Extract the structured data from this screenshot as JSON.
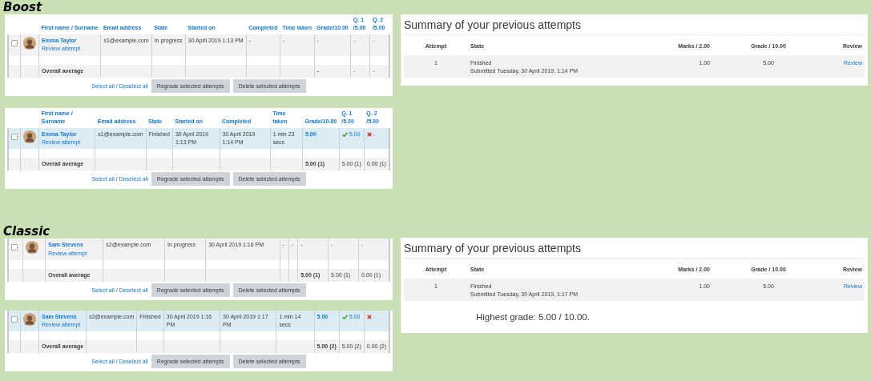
{
  "sections": [
    {
      "title": "Boost",
      "attempt_tables": [
        {
          "columns": [
            "First name / Surname",
            "Email address",
            "State",
            "Started on",
            "Completed",
            "Time taken",
            "Grade/10.00",
            "Q. 1 /5.00",
            "Q. 2 /5.00"
          ],
          "rows": [
            {
              "checked": false,
              "highlighted": false,
              "name": "Emma Taylor",
              "review": "Review attempt",
              "email": "s1@example.com",
              "state": "In progress",
              "started": "30 April 2019 1:13 PM",
              "completed": "-",
              "time_taken": "-",
              "grade": "-",
              "grade_linked": false,
              "questions": [
                {
                  "mark": "-",
                  "kind": "plain"
                },
                {
                  "mark": "-",
                  "kind": "plain"
                }
              ]
            }
          ],
          "average": {
            "label": "Overall average",
            "grade": "-",
            "questions": [
              "-",
              "-"
            ]
          },
          "select_links": [
            "Select all",
            "Deselect all"
          ],
          "separator": "/",
          "buttons": [
            "Regrade selected attempts",
            "Delete selected attempts"
          ]
        },
        {
          "columns": [
            "First name / Surname",
            "Email address",
            "State",
            "Started on",
            "Completed",
            "Time taken",
            "Grade/10.00",
            "Q. 1 /5.00",
            "Q. 2 /5.00"
          ],
          "rows": [
            {
              "checked": false,
              "highlighted": true,
              "name": "Emma Taylor",
              "review": "Review attempt",
              "email": "s1@example.com",
              "state": "Finished",
              "started": "30 April 2019 1:13 PM",
              "completed": "30 April 2019 1:14 PM",
              "time_taken": "1 min 23 secs",
              "grade": "5.00",
              "grade_linked": true,
              "questions": [
                {
                  "mark": "5.00",
                  "kind": "correct"
                },
                {
                  "mark": "-",
                  "kind": "incorrect"
                }
              ]
            }
          ],
          "average": {
            "label": "Overall average",
            "grade": "5.00 (1)",
            "questions": [
              "5.00 (1)",
              "0.00 (1)"
            ]
          },
          "select_links": [
            "Select all",
            "Deselect all"
          ],
          "separator": "/",
          "buttons": [
            "Regrade selected attempts",
            "Delete selected attempts"
          ]
        }
      ],
      "summary": {
        "title": "Summary of your previous attempts",
        "columns": [
          "Attempt",
          "State",
          "Marks / 2.00",
          "Grade / 10.00",
          "Review"
        ],
        "rows": [
          {
            "attempt": "1",
            "state": "Finished",
            "submitted": "Submitted Tuesday, 30 April 2019, 1:14 PM",
            "marks": "1.00",
            "grade": "5.00",
            "review": "Review"
          }
        ]
      }
    },
    {
      "title": "Classic",
      "attempt_tables": [
        {
          "rows": [
            {
              "checked": false,
              "highlighted": false,
              "name": "Sam Stevens",
              "review": "Review attempt",
              "email": "s2@example.com",
              "state": "In progress",
              "started": "30 April 2019 1:16 PM",
              "completed": "-",
              "time_taken": "-",
              "grade": "-",
              "grade_linked": false,
              "questions": [
                {
                  "mark": "-",
                  "kind": "plain"
                },
                {
                  "mark": "-",
                  "kind": "plain"
                }
              ]
            }
          ],
          "average": {
            "label": "Overall average",
            "grade": "5.00 (1)",
            "questions": [
              "5.00 (1)",
              "0.00 (1)"
            ]
          },
          "select_links": [
            "Select all",
            "Deselect all"
          ],
          "separator": "/",
          "buttons": [
            "Regrade selected attempts",
            "Delete selected attempts"
          ]
        },
        {
          "rows": [
            {
              "checked": false,
              "highlighted": true,
              "name": "Sam Stevens",
              "review": "Review attempt",
              "email": "s2@example.com",
              "state": "Finished",
              "started": "30 April 2019 1:16 PM",
              "completed": "30 April 2019 1:17 PM",
              "time_taken": "1 min 14 secs",
              "grade": "5.00",
              "grade_linked": true,
              "questions": [
                {
                  "mark": "5.00",
                  "kind": "correct"
                },
                {
                  "mark": "-",
                  "kind": "incorrect"
                }
              ]
            }
          ],
          "average": {
            "label": "Overall average",
            "grade": "5.00 (2)",
            "questions": [
              "5.00 (2)",
              "0.00 (2)"
            ]
          },
          "select_links": [
            "Select all",
            "Deselect all"
          ],
          "separator": "/",
          "buttons": [
            "Regrade selected attempts",
            "Delete selected attempts"
          ]
        }
      ],
      "summary": {
        "title": "Summary of your previous attempts",
        "columns": [
          "Attempt",
          "State",
          "Marks / 2.00",
          "Grade / 10.00",
          "Review"
        ],
        "rows": [
          {
            "attempt": "1",
            "state": "Finished",
            "submitted": "Submitted Tuesday, 30 April 2019, 1:17 PM",
            "marks": "1.00",
            "grade": "5.00",
            "review": "Review"
          }
        ],
        "highest_grade": "Highest grade: 5.00 / 10.00."
      }
    }
  ]
}
